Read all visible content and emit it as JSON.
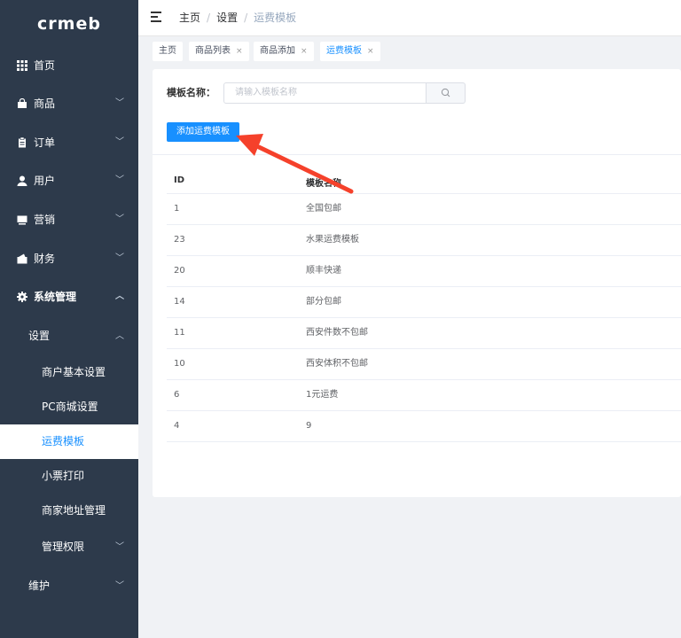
{
  "logo": "crmeb",
  "sidebar": {
    "items": [
      {
        "label": "首页",
        "chevron": ""
      },
      {
        "label": "商品",
        "chevron": "﹀"
      },
      {
        "label": "订单",
        "chevron": "﹀"
      },
      {
        "label": "用户",
        "chevron": "﹀"
      },
      {
        "label": "营销",
        "chevron": "﹀"
      },
      {
        "label": "财务",
        "chevron": "﹀"
      },
      {
        "label": "系统管理",
        "chevron": "︿"
      }
    ],
    "settings": {
      "label": "设置",
      "chevron": "︿"
    },
    "settings_children": [
      {
        "label": "商户基本设置"
      },
      {
        "label": "PC商城设置"
      },
      {
        "label": "运费模板"
      },
      {
        "label": "小票打印"
      },
      {
        "label": "商家地址管理"
      },
      {
        "label": "管理权限",
        "chevron": "﹀"
      }
    ],
    "maintenance": {
      "label": "维护",
      "chevron": "﹀"
    }
  },
  "breadcrumb": {
    "home": "主页",
    "sep": "/",
    "settings": "设置",
    "current": "运费模板"
  },
  "tabs": [
    {
      "label": "主页",
      "close": ""
    },
    {
      "label": "商品列表",
      "close": "×"
    },
    {
      "label": "商品添加",
      "close": "×"
    },
    {
      "label": "运费模板",
      "close": "×"
    }
  ],
  "form": {
    "label": "模板名称：",
    "placeholder": "请输入模板名称",
    "add_button": "添加运费模板"
  },
  "table": {
    "headers": [
      "ID",
      "模板名称"
    ],
    "rows": [
      {
        "id": "1",
        "name": "全国包邮"
      },
      {
        "id": "23",
        "name": "水果运费模板"
      },
      {
        "id": "20",
        "name": "顺丰快递"
      },
      {
        "id": "14",
        "name": "部分包邮"
      },
      {
        "id": "11",
        "name": "西安件数不包邮"
      },
      {
        "id": "10",
        "name": "西安体积不包邮"
      },
      {
        "id": "6",
        "name": "1元运费"
      },
      {
        "id": "4",
        "name": "9"
      }
    ]
  },
  "colors": {
    "sidebar_bg": "#2d3a4b",
    "accent": "#1890ff",
    "annotation_arrow": "#f5412b"
  }
}
